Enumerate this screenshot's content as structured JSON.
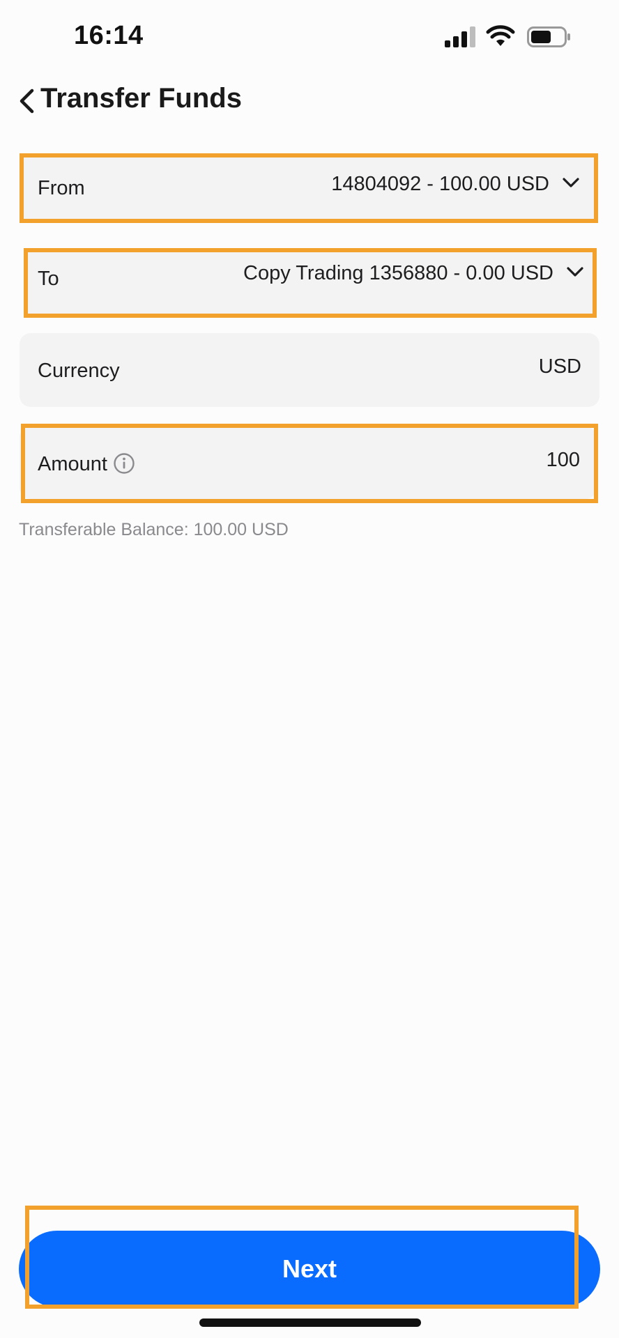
{
  "status_bar": {
    "time": "16:14",
    "icons": [
      "signal-icon",
      "wifi-icon",
      "battery-icon"
    ]
  },
  "header": {
    "title": "Transfer Funds",
    "back_icon": "chevron-left-icon"
  },
  "form": {
    "from": {
      "label": "From",
      "value": "14804092 - 100.00 USD",
      "icon": "chevron-down-icon"
    },
    "to": {
      "label": "To",
      "value": "Copy Trading 1356880 - 0.00 USD",
      "icon": "chevron-down-icon"
    },
    "currency": {
      "label": "Currency",
      "value": "USD"
    },
    "amount": {
      "label": "Amount",
      "value": "100",
      "icon": "info-icon"
    },
    "balance_note": "Transferable Balance: 100.00 USD"
  },
  "actions": {
    "next_label": "Next"
  },
  "colors": {
    "primary_button": "#0a6cff",
    "highlight_border": "#f2a22c",
    "row_background": "#f3f3f3",
    "muted_text": "#8a8a8e"
  }
}
